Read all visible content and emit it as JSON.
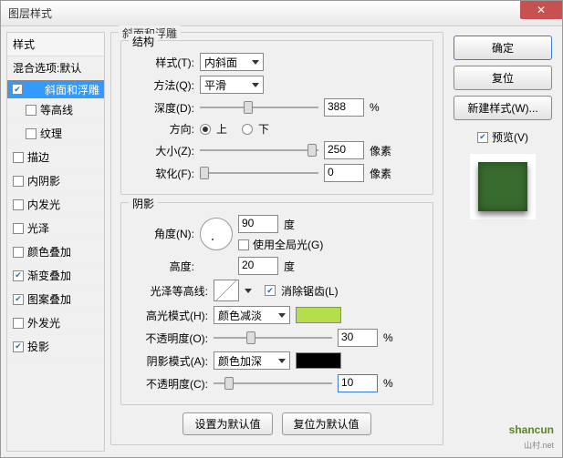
{
  "window": {
    "title": "图层样式"
  },
  "left": {
    "header": "样式",
    "blend": "混合选项:默认",
    "items": [
      {
        "label": "斜面和浮雕",
        "checked": true,
        "selected": true
      },
      {
        "label": "等高线",
        "checked": false,
        "sub": true
      },
      {
        "label": "纹理",
        "checked": false,
        "sub": true
      },
      {
        "label": "描边",
        "checked": false
      },
      {
        "label": "内阴影",
        "checked": false
      },
      {
        "label": "内发光",
        "checked": false
      },
      {
        "label": "光泽",
        "checked": false
      },
      {
        "label": "颜色叠加",
        "checked": false
      },
      {
        "label": "渐变叠加",
        "checked": true
      },
      {
        "label": "图案叠加",
        "checked": true
      },
      {
        "label": "外发光",
        "checked": false
      },
      {
        "label": "投影",
        "checked": true
      }
    ]
  },
  "main": {
    "title": "斜面和浮雕",
    "structure": {
      "title": "结构",
      "style_label": "样式(T):",
      "style_value": "内斜面",
      "technique_label": "方法(Q):",
      "technique_value": "平滑",
      "depth_label": "深度(D):",
      "depth_value": "388",
      "depth_unit": "%",
      "direction_label": "方向:",
      "up": "上",
      "down": "下",
      "size_label": "大小(Z):",
      "size_value": "250",
      "size_unit": "像素",
      "soften_label": "软化(F):",
      "soften_value": "0",
      "soften_unit": "像素"
    },
    "shading": {
      "title": "阴影",
      "angle_label": "角度(N):",
      "angle_value": "90",
      "angle_unit": "度",
      "global_label": "使用全局光(G)",
      "altitude_label": "高度:",
      "altitude_value": "20",
      "altitude_unit": "度",
      "gloss_label": "光泽等高线:",
      "antialias_label": "消除锯齿(L)",
      "highlight_mode_label": "高光模式(H):",
      "highlight_mode_value": "颜色减淡",
      "highlight_color": "#b3e04a",
      "highlight_opacity_label": "不透明度(O):",
      "highlight_opacity_value": "30",
      "highlight_opacity_unit": "%",
      "shadow_mode_label": "阴影模式(A):",
      "shadow_mode_value": "颜色加深",
      "shadow_color": "#000000",
      "shadow_opacity_label": "不透明度(C):",
      "shadow_opacity_value": "10",
      "shadow_opacity_unit": "%"
    },
    "make_default": "设置为默认值",
    "reset_default": "复位为默认值"
  },
  "right": {
    "ok": "确定",
    "cancel": "复位",
    "new_style": "新建样式(W)...",
    "preview": "预览(V)"
  },
  "watermark": {
    "brand": "shan",
    "brand2": "cun",
    "sub": "山村.net"
  }
}
